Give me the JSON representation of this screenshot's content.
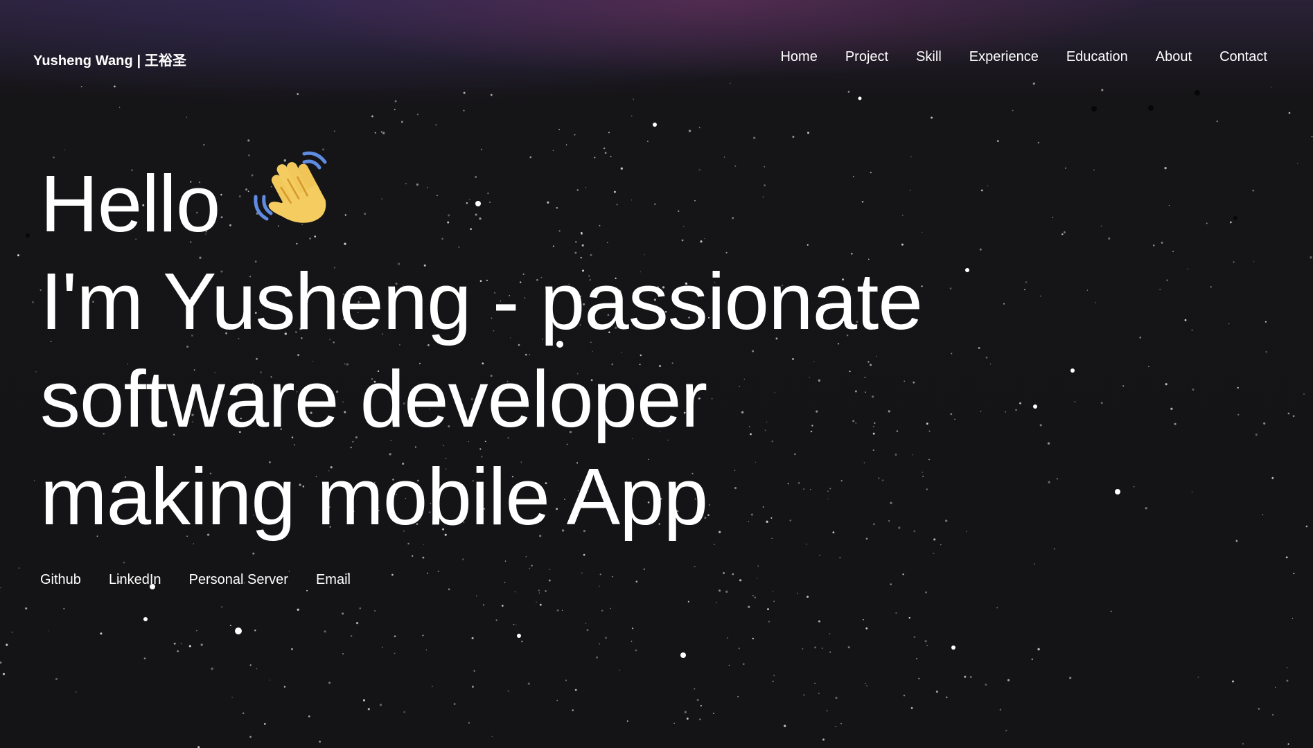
{
  "header": {
    "brand": "Yusheng Wang | 王裕圣",
    "nav": [
      {
        "label": "Home"
      },
      {
        "label": "Project"
      },
      {
        "label": "Skill"
      },
      {
        "label": "Experience"
      },
      {
        "label": "Education"
      },
      {
        "label": "About"
      },
      {
        "label": "Contact"
      }
    ]
  },
  "hero": {
    "greeting": "Hello",
    "greeting_icon": "waving-hand-icon",
    "lines": [
      "I'm Yusheng - passionate",
      "software developer",
      "making mobile App"
    ]
  },
  "social": [
    {
      "label": "Github"
    },
    {
      "label": "LinkedIn"
    },
    {
      "label": "Personal Server"
    },
    {
      "label": "Email"
    }
  ],
  "colors": {
    "background": "#141315",
    "text": "#ffffff",
    "header_glow": "#6e325f"
  }
}
